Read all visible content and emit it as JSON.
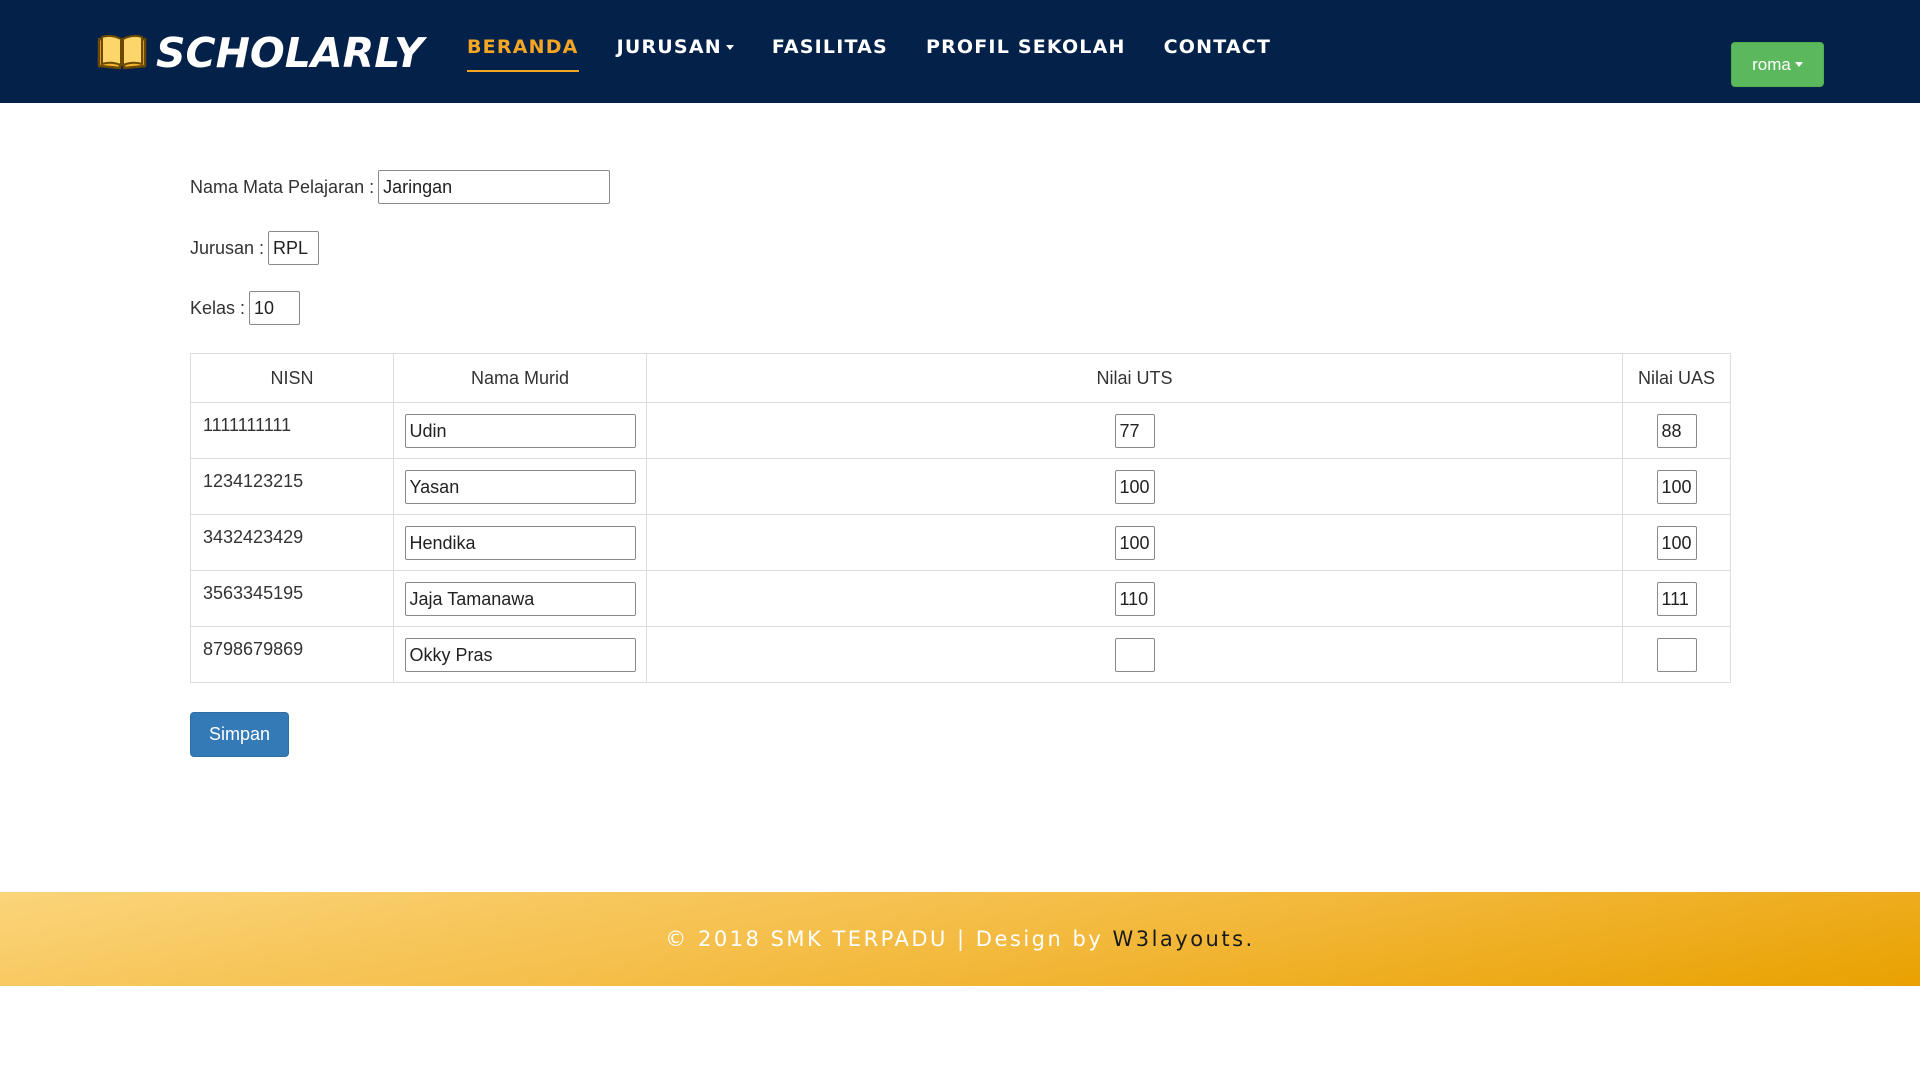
{
  "header": {
    "brand": "SCHOLARLY",
    "nav": [
      {
        "label": "BERANDA",
        "active": true,
        "dropdown": false
      },
      {
        "label": "JURUSAN",
        "active": false,
        "dropdown": true
      },
      {
        "label": "FASILITAS",
        "active": false,
        "dropdown": false
      },
      {
        "label": "PROFIL SEKOLAH",
        "active": false,
        "dropdown": false
      },
      {
        "label": "CONTACT",
        "active": false,
        "dropdown": false
      }
    ],
    "user": "roma"
  },
  "form": {
    "subject_label": "Nama Mata Pelajaran :",
    "subject_value": "Jaringan",
    "major_label": "Jurusan :",
    "major_value": "RPL",
    "class_label": "Kelas :",
    "class_value": "10"
  },
  "table": {
    "headers": [
      "NISN",
      "Nama Murid",
      "Nilai UTS",
      "Nilai UAS"
    ],
    "rows": [
      {
        "nisn": "1111111111",
        "nama": "Udin",
        "uts": "77",
        "uas": "88"
      },
      {
        "nisn": "1234123215",
        "nama": "Yasan",
        "uts": "100",
        "uas": "100"
      },
      {
        "nisn": "3432423429",
        "nama": "Hendika",
        "uts": "100",
        "uas": "100"
      },
      {
        "nisn": "3563345195",
        "nama": "Jaja Tamanawa",
        "uts": "110",
        "uas": "111"
      },
      {
        "nisn": "8798679869",
        "nama": "Okky Pras",
        "uts": "",
        "uas": ""
      }
    ]
  },
  "save_label": "Simpan",
  "footer": {
    "text": "© 2018 SMK TERPADU | Design by ",
    "link": "W3layouts."
  },
  "colors": {
    "header_bg": "#04214a",
    "accent": "#f5a623",
    "user_button": "#5cb85c",
    "save_button": "#337ab7"
  }
}
